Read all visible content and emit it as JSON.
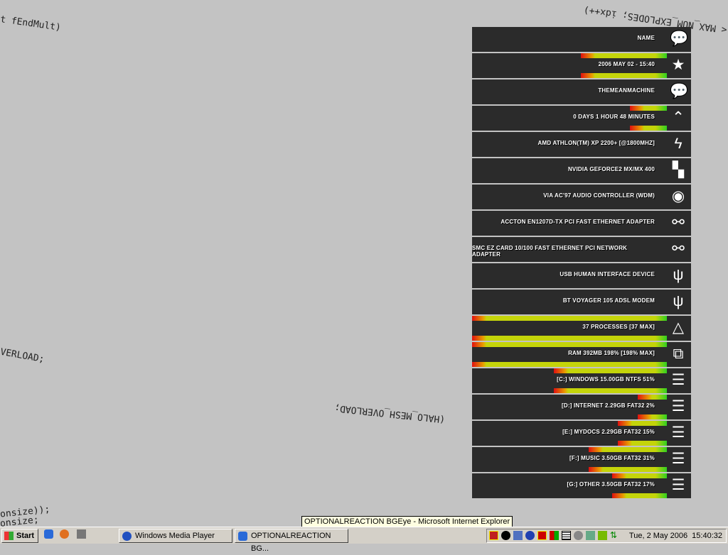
{
  "background_code": [
    "t fEndMult)",
    "< MAX_NUM_EXPLODES; idx++)",
    "VERLOAD;",
    "(HALO_MESH_OVERLOAD;",
    "onsize));",
    "onsize;"
  ],
  "panel": {
    "rows": [
      {
        "label": "NAME",
        "icon": "speech-bubble-icon",
        "glyph": "💬",
        "bar": null
      },
      {
        "label": "2006 MAY 02 - 15:40",
        "icon": "star-icon",
        "glyph": "★",
        "bar": 0.44
      },
      {
        "label": "THEMEANMACHINE",
        "icon": "speech-bubble-icon",
        "glyph": "💬",
        "bar": null
      },
      {
        "label": "0 DAYS 1 HOUR 48 MINUTES",
        "icon": "double-chevron-up-icon",
        "glyph": "⌃",
        "bar": 0.19
      },
      {
        "label": "AMD ATHLON(TM) XP 2200+ [@1800MHZ]",
        "icon": "lightning-icon",
        "glyph": "ϟ",
        "bar": null
      },
      {
        "label": "NVIDIA GEFORCE2 MX/MX 400",
        "icon": "checker-icon",
        "glyph": "▚",
        "bar": null
      },
      {
        "label": "VIA AC'97 AUDIO CONTROLLER (WDM)",
        "icon": "disc-icon",
        "glyph": "◉",
        "bar": null
      },
      {
        "label": "ACCTON EN1207D-TX PCI FAST ETHERNET ADAPTER",
        "icon": "network-icon",
        "glyph": "⚯",
        "bar": null
      },
      {
        "label": "SMC EZ CARD 10/100 FAST ETHERNET PCI NETWORK ADAPTER",
        "icon": "network-icon",
        "glyph": "⚯",
        "bar": null
      },
      {
        "label": "USB HUMAN INTERFACE DEVICE",
        "icon": "usb-icon",
        "glyph": "ψ",
        "bar": null
      },
      {
        "label": "BT VOYAGER 105 ADSL MODEM",
        "icon": "usb-icon",
        "glyph": "ψ",
        "bar": null
      },
      {
        "label": "37 PROCESSES [37 MAX]",
        "icon": "triangle-icon",
        "glyph": "△",
        "bar": 1.0
      },
      {
        "label": "RAM 392MB 198% [198% MAX]",
        "icon": "windows-stack-icon",
        "glyph": "⧉",
        "bar": 1.0
      },
      {
        "label": "[C:] WINDOWS 15.00GB NTFS 51%",
        "icon": "disk-stack-icon",
        "glyph": "☰",
        "bar": 0.58
      },
      {
        "label": "[D:] INTERNET 2.29GB FAT32 2%",
        "icon": "disk-stack-icon",
        "glyph": "☰",
        "bar": 0.15
      },
      {
        "label": "[E:] MYDOCS 2.29GB FAT32 15%",
        "icon": "disk-stack-icon",
        "glyph": "☰",
        "bar": 0.25
      },
      {
        "label": "[F:] MUSIC 3.50GB FAT32 31%",
        "icon": "disk-stack-icon",
        "glyph": "☰",
        "bar": 0.4
      },
      {
        "label": "[G:] OTHER 3.50GB FAT32 17%",
        "icon": "disk-stack-icon",
        "glyph": "☰",
        "bar": 0.28
      }
    ]
  },
  "tooltip": "OPTIONALREACTION BGEye - Microsoft Internet Explorer",
  "taskbar": {
    "start": "Start",
    "tasks": [
      "Windows Media Player",
      "OPTIONALREACTION BG..."
    ],
    "clock": "Tue, 2 May 2006  15:40:32"
  }
}
